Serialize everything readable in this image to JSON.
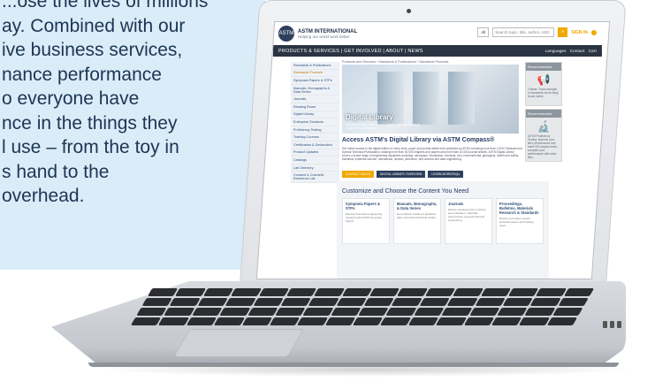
{
  "left_text": {
    "line1": "...ose the lives of millions",
    "line2": "ay. Combined with our",
    "line3": "ive business services,",
    "line4": "nance performance",
    "line5": "o everyone have",
    "line6": "nce in the things they",
    "line7": "l use – from the toy in",
    "line8": "s hand to the",
    "line9": "overhead."
  },
  "site": {
    "brand": "ASTM INTERNATIONAL",
    "tagline": "Helping our world work better",
    "select_value": "All",
    "search_placeholder": "Search topic, title, author, ASD",
    "signin": "SIGN IN",
    "nav": "PRODUCTS & SERVICES  |  GET INVOLVED  |  ABOUT  |  NEWS",
    "nav_right": [
      "Languages",
      "Contact",
      "Cart"
    ],
    "breadcrumb": "Products and Services › Standards & Publications › Standards Products",
    "sidebar": [
      "Standards & Publications",
      "Standards Products",
      "Symposia Papers & STPs",
      "Manuals, Monographs & Data Series",
      "Journals",
      "Reading Room",
      "Digital Library",
      "Enterprise Solutions",
      "Proficiency Testing",
      "Training Courses",
      "Certification & Declaration",
      "Product Updates",
      "Catalogs",
      "Lab Directory",
      "Consent & Cosmetic Reference List"
    ],
    "hero_title": "Digital Library",
    "hero_desc": "Discover a vast collection of industry-leading technical engineering information",
    "access_title": "Access ASTM's Digital Library via ASTM Compass®",
    "paragraph": "Get online access to the digital edition of every book, paper and journal article ever published by ASTM including more than 1,500+ Manuals and Special Technical Publications, totaling more than 30,000 chapters and papers and more than 10,000 journal articles. ASTM Digital Library covers a broad range of engineering disciplines including: aerospace, biomedical, chemical, civil, environmental, geological, health and safety, industrial, materials science, mechanical, nuclear, petroleum, and science and data engineering.",
    "buttons": [
      "CONTACT SALES",
      "DIGITAL LIBRARY OVERVIEW",
      "LEARN MORE/FAQs"
    ],
    "recommended_head": "Recommended",
    "recommended_text": "Tracker: Track changes to standards via an easy, visual online",
    "recommended2_head": "Recommended",
    "recommended2_text": "ASTM Proficiency Testing: Improve your lab's performance and meet ISO requirements, compare your performance with other labs.",
    "customize_title": "Customize and Choose the Content You Need",
    "columns": [
      {
        "title": "Symposia Papers & STPs",
        "desc": "Discover the latest engineering research with ASTM Symposia Papers"
      },
      {
        "title": "Manuals, Monographs, & Data Series",
        "desc": "Get practical, hands-on guidance, data, and tested technical insight"
      },
      {
        "title": "Journals",
        "desc": "Explore developments in testing and evaluation, materials performance, geotechnical and engineering"
      },
      {
        "title": "Proceedings, Bulletins, Materials Research & Standards",
        "desc": "Review committee reports, technical papers and industry news"
      }
    ]
  }
}
